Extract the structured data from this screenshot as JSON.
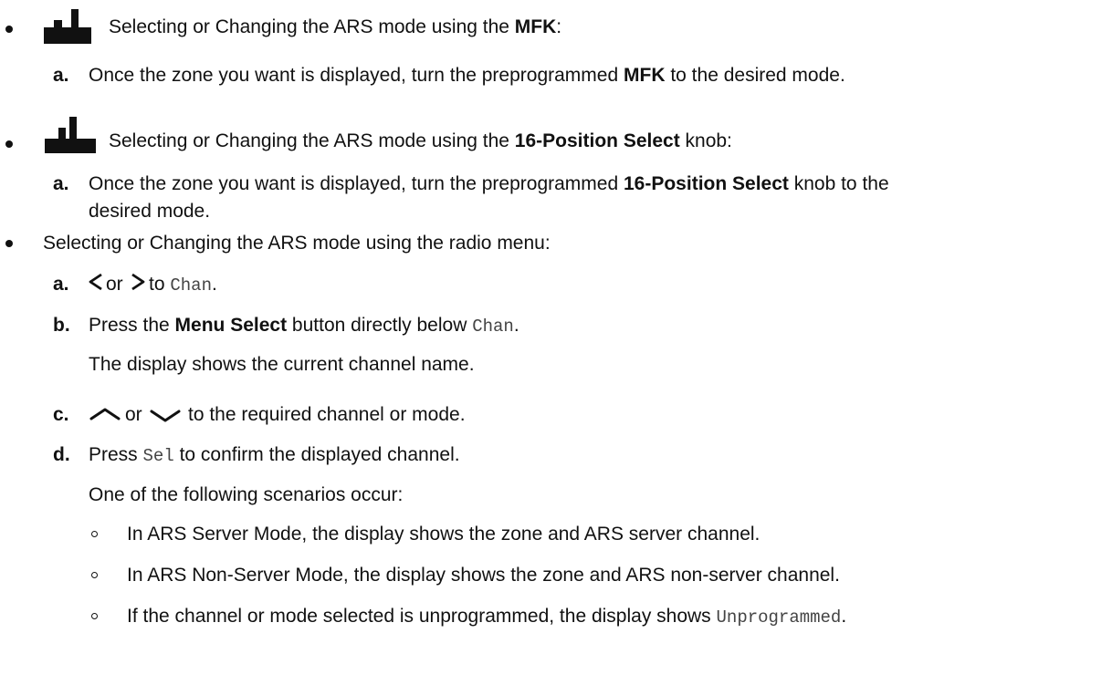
{
  "section1": {
    "intro_pre": "Selecting or Changing the ARS mode using the ",
    "intro_bold": "MFK",
    "intro_post": ":",
    "step_a": {
      "letter": "a.",
      "pre": "Once the zone you want is displayed, turn the preprogrammed ",
      "bold": "MFK",
      "post": " to the desired mode."
    }
  },
  "section2": {
    "intro_pre": "Selecting or Changing the ARS mode using the ",
    "intro_bold": "16-Position Select",
    "intro_post": " knob:",
    "step_a": {
      "letter": "a.",
      "pre": "Once the zone you want is displayed, turn the preprogrammed ",
      "bold": "16-Position Select",
      "post": " knob to the",
      "line2": "desired mode."
    }
  },
  "section3": {
    "intro": "Selecting or Changing the ARS mode using the radio menu:",
    "step_a": {
      "letter": "a.",
      "or": "or",
      "to": "to",
      "code": "Chan",
      "end": "."
    },
    "step_b": {
      "letter": "b.",
      "pre": "Press the ",
      "bold": "Menu Select",
      "mid": " button directly below ",
      "code": "Chan",
      "end": ".",
      "result": "The display shows the current channel name."
    },
    "step_c": {
      "letter": "c.",
      "or": "or",
      "post": "to the required channel or mode."
    },
    "step_d": {
      "letter": "d.",
      "pre": "Press ",
      "code": "Sel",
      "post": " to confirm the displayed channel.",
      "result": "One of the following scenarios occur:",
      "scenarios": [
        "In ARS Server Mode, the display shows the zone and ARS server channel.",
        "In ARS Non-Server Mode, the display shows the zone and ARS non-server channel."
      ],
      "scenario3_pre": "If the channel or mode selected is unprogrammed, the display shows ",
      "scenario3_code": "Unprogrammed",
      "scenario3_end": "."
    }
  }
}
